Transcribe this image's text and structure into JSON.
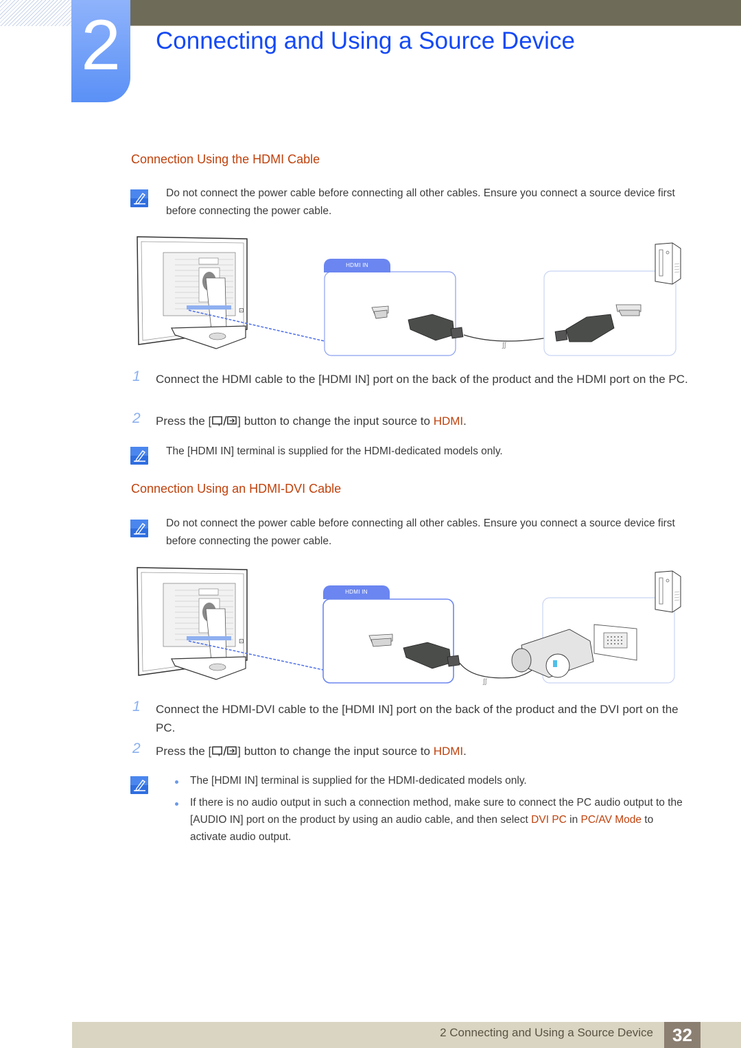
{
  "header": {
    "chapter_number": "2",
    "chapter_title": "Connecting and Using a Source Device"
  },
  "section_hdmi": {
    "title": "Connection Using the HDMI Cable",
    "note": "Do not connect the power cable before connecting all other cables. Ensure you connect a source device first before connecting the power cable.",
    "diagram": {
      "port_label": "HDMI IN"
    },
    "steps": [
      {
        "num": "1",
        "text": "Connect the HDMI cable to the [HDMI IN] port on the back of the product and the HDMI port on the PC."
      },
      {
        "num": "2",
        "prefix": "Press the [",
        "suffix": "] button to change the input source to ",
        "highlight": "HDMI",
        "end": "."
      }
    ],
    "footnote": "The [HDMI IN] terminal is supplied for the HDMI-dedicated models only."
  },
  "section_hdmi_dvi": {
    "title": "Connection Using an HDMI-DVI Cable",
    "note": "Do not connect the power cable before connecting all other cables. Ensure you connect a source device first before connecting the power cable.",
    "diagram": {
      "port_label": "HDMI IN"
    },
    "steps": [
      {
        "num": "1",
        "text": "Connect the HDMI-DVI cable to the [HDMI IN] port on the back of the product and the DVI port on the PC."
      },
      {
        "num": "2",
        "prefix": "Press the [",
        "suffix": "] button to change the input source to ",
        "highlight": "HDMI",
        "end": "."
      }
    ],
    "footnotes": [
      {
        "text": "The [HDMI IN] terminal is supplied for the HDMI-dedicated models only."
      },
      {
        "pre": "If there is no audio output in such a connection method, make sure to connect the PC audio output to the [AUDIO IN] port on the product by using an audio cable, and then select ",
        "hl1": "DVI PC",
        "mid": " in ",
        "hl2": "PC/AV Mode",
        "post": " to activate audio output."
      }
    ]
  },
  "footer": {
    "text": "2 Connecting and Using a Source Device",
    "page_number": "32"
  },
  "colors": {
    "accent_blue": "#1449f5",
    "section_orange": "#c0420d",
    "tab_blue": "#5a90f6",
    "topbar": "#6e6b58",
    "footer_bg": "#dad5c2",
    "page_num_bg": "#8b7f72"
  }
}
